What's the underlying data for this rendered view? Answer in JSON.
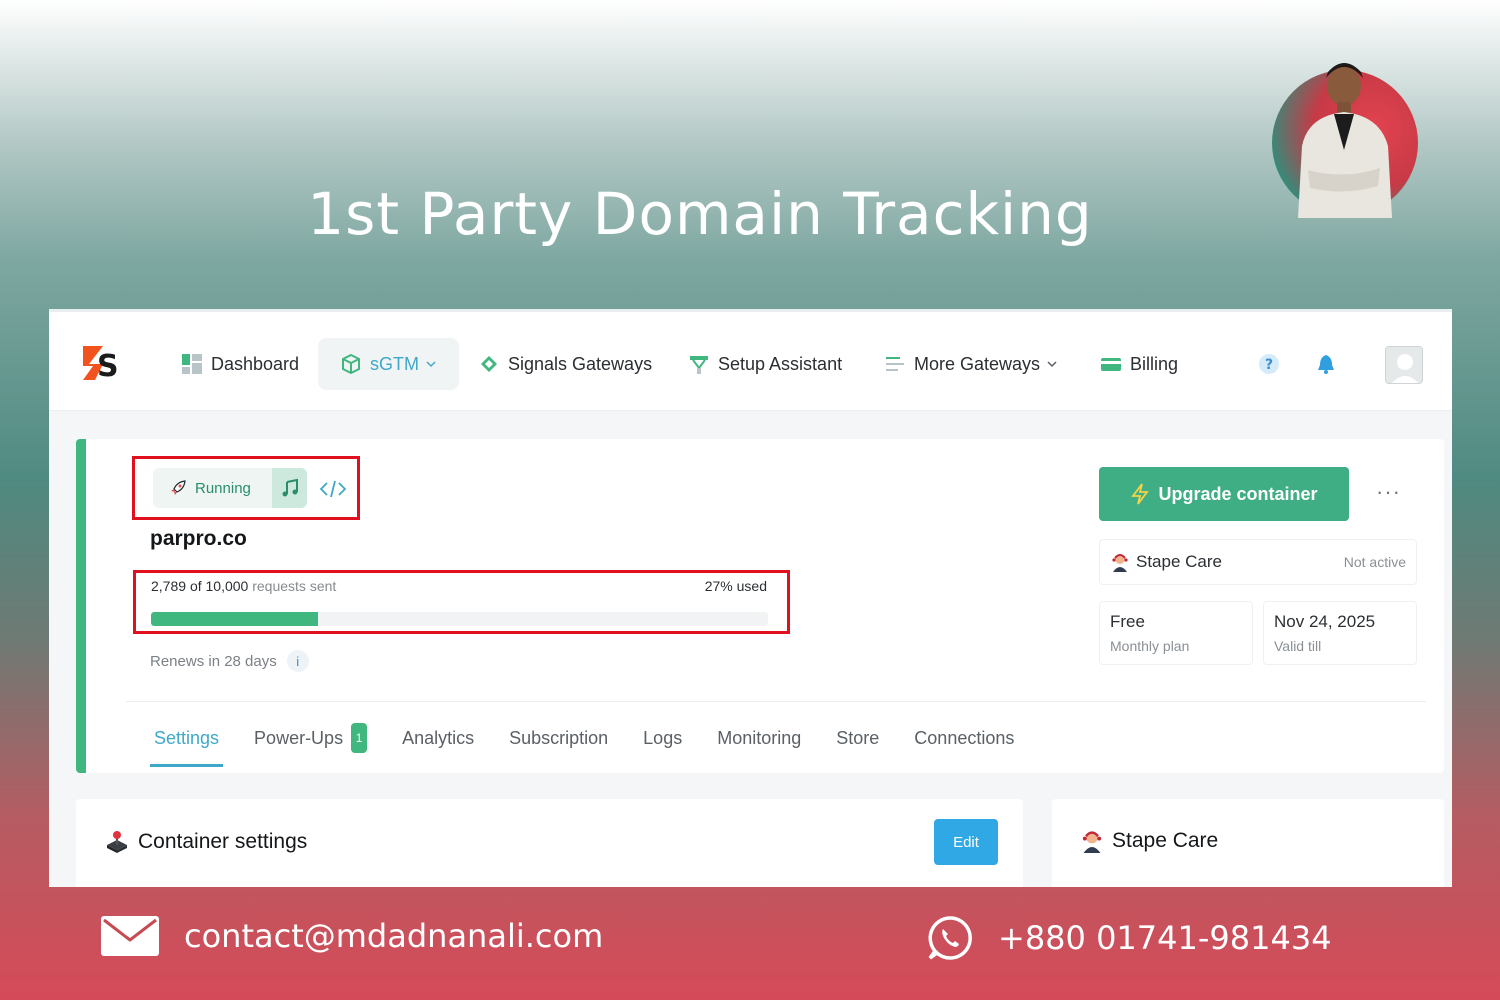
{
  "banner": {
    "headline": "1st Party Domain Tracking"
  },
  "nav": {
    "items": [
      {
        "label": "Dashboard",
        "icon": "dashboard-grid-icon"
      },
      {
        "label": "sGTM",
        "icon": "cube-icon",
        "active": true
      },
      {
        "label": "Signals Gateways",
        "icon": "diamond-icon"
      },
      {
        "label": "Setup Assistant",
        "icon": "assistant-icon"
      },
      {
        "label": "More Gateways",
        "icon": "list-icon"
      },
      {
        "label": "Billing",
        "icon": "card-icon"
      }
    ],
    "icons": [
      "help-icon",
      "bell-icon",
      "user-avatar-icon"
    ]
  },
  "container": {
    "status": "Running",
    "domain": "parpro.co",
    "usage": {
      "used": "2,789",
      "of": "of",
      "total": "10,000",
      "suffix": "requests sent",
      "percent_label": "27% used",
      "fraction": 0.27
    },
    "renews": "Renews in 28 days",
    "info": "i"
  },
  "tabs": [
    {
      "label": "Settings",
      "active": true
    },
    {
      "label": "Power-Ups",
      "badge": "1"
    },
    {
      "label": "Analytics"
    },
    {
      "label": "Subscription"
    },
    {
      "label": "Logs"
    },
    {
      "label": "Monitoring"
    },
    {
      "label": "Store"
    },
    {
      "label": "Connections"
    }
  ],
  "side": {
    "upgrade_label": "Upgrade container",
    "more": "···",
    "care_label": "Stape Care",
    "care_status": "Not active",
    "plan_name": "Free",
    "plan_desc": "Monthly plan",
    "valid_date": "Nov 24, 2025",
    "valid_desc": "Valid till"
  },
  "panels": {
    "settings_title": "Container settings",
    "edit_label": "Edit",
    "care_title": "Stape Care"
  },
  "footer": {
    "email": "contact@mdadnanali.com",
    "phone": "+880 01741-981434"
  },
  "colors": {
    "accent_green": "#3fb77f",
    "accent_blue": "#3fa8c9",
    "highlight_red": "#e0101e",
    "edit_blue": "#31a8e6"
  }
}
